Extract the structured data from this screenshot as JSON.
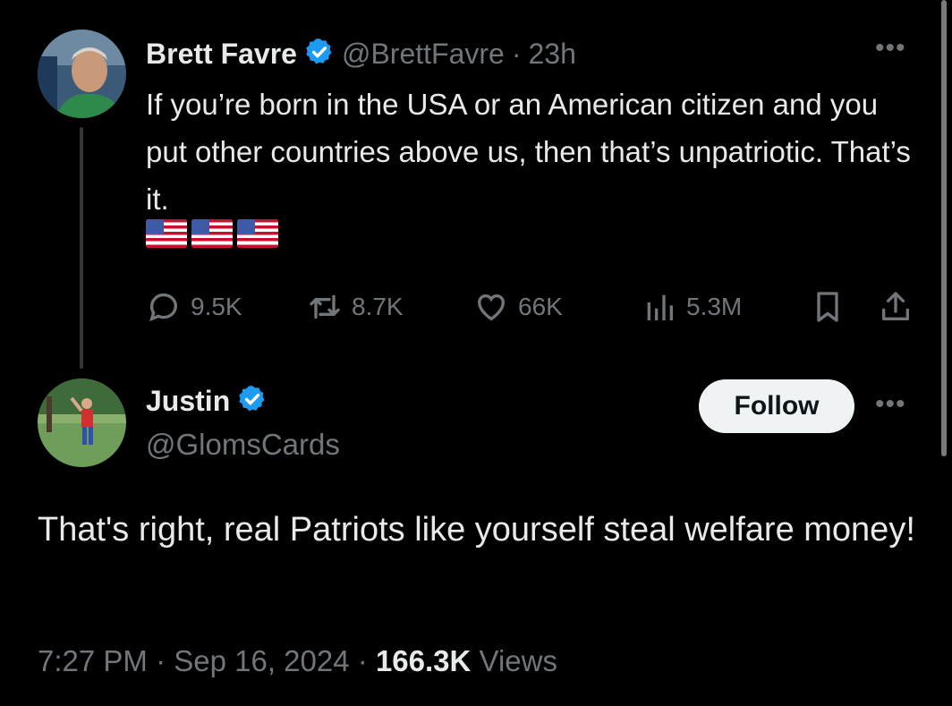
{
  "colors": {
    "background": "#000000",
    "text_primary": "#e7e9ea",
    "text_secondary": "#71767b",
    "verified_blue": "#1d9bf0",
    "follow_button_bg": "#eff3f4"
  },
  "tweet": {
    "author_name": "Brett Favre",
    "handle": "@BrettFavre",
    "separator": "·",
    "time": "23h",
    "more_icon": "more-horizontal-icon",
    "text": "If you’re born in the USA or an American citizen and you put other countries above us, then that’s unpatriotic. That’s it.",
    "emoji": [
      "us-flag",
      "us-flag",
      "us-flag"
    ],
    "actions": {
      "replies": "9.5K",
      "reposts": "8.7K",
      "likes": "66K",
      "views": "5.3M"
    }
  },
  "reply": {
    "author_name": "Justin",
    "handle": "@GlomsCards",
    "follow_label": "Follow",
    "text": "That's right, real Patriots like yourself steal welfare money!",
    "time": "7:27 PM",
    "date": "Sep 16, 2024",
    "separator": "·",
    "views_count": "166.3K",
    "views_label": "Views"
  }
}
